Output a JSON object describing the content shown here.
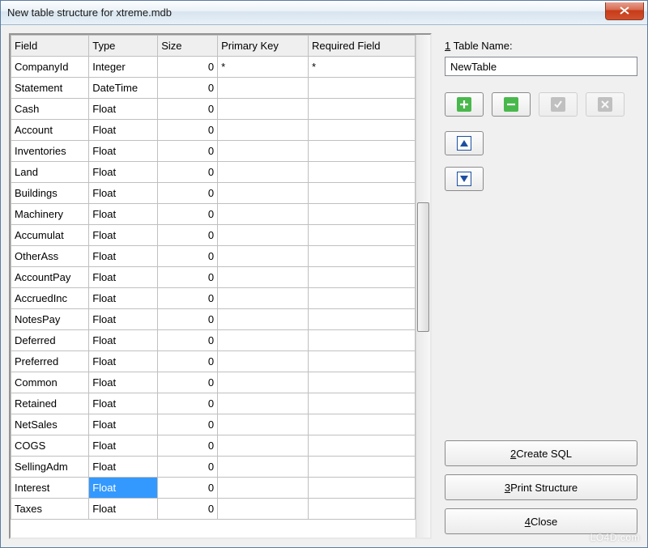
{
  "window": {
    "title": "New table structure for xtreme.mdb"
  },
  "columns": {
    "field": "Field",
    "type": "Type",
    "size": "Size",
    "pk": "Primary Key",
    "req": "Required Field"
  },
  "rows": [
    {
      "field": "CompanyId",
      "type": "Integer",
      "size": "0",
      "pk": "*",
      "req": "*"
    },
    {
      "field": "Statement",
      "type": "DateTime",
      "size": "0",
      "pk": "",
      "req": ""
    },
    {
      "field": "Cash",
      "type": "Float",
      "size": "0",
      "pk": "",
      "req": ""
    },
    {
      "field": "Account",
      "type": "Float",
      "size": "0",
      "pk": "",
      "req": ""
    },
    {
      "field": "Inventories",
      "type": "Float",
      "size": "0",
      "pk": "",
      "req": ""
    },
    {
      "field": "Land",
      "type": "Float",
      "size": "0",
      "pk": "",
      "req": ""
    },
    {
      "field": "Buildings",
      "type": "Float",
      "size": "0",
      "pk": "",
      "req": ""
    },
    {
      "field": "Machinery",
      "type": "Float",
      "size": "0",
      "pk": "",
      "req": ""
    },
    {
      "field": "Accumulat",
      "type": "Float",
      "size": "0",
      "pk": "",
      "req": ""
    },
    {
      "field": "OtherAss",
      "type": "Float",
      "size": "0",
      "pk": "",
      "req": ""
    },
    {
      "field": "AccountPay",
      "type": "Float",
      "size": "0",
      "pk": "",
      "req": ""
    },
    {
      "field": "AccruedInc",
      "type": "Float",
      "size": "0",
      "pk": "",
      "req": ""
    },
    {
      "field": "NotesPay",
      "type": "Float",
      "size": "0",
      "pk": "",
      "req": ""
    },
    {
      "field": "Deferred",
      "type": "Float",
      "size": "0",
      "pk": "",
      "req": ""
    },
    {
      "field": "Preferred",
      "type": "Float",
      "size": "0",
      "pk": "",
      "req": ""
    },
    {
      "field": "Common",
      "type": "Float",
      "size": "0",
      "pk": "",
      "req": ""
    },
    {
      "field": "Retained",
      "type": "Float",
      "size": "0",
      "pk": "",
      "req": ""
    },
    {
      "field": "NetSales",
      "type": "Float",
      "size": "0",
      "pk": "",
      "req": ""
    },
    {
      "field": "COGS",
      "type": "Float",
      "size": "0",
      "pk": "",
      "req": ""
    },
    {
      "field": "SellingAdm",
      "type": "Float",
      "size": "0",
      "pk": "",
      "req": ""
    },
    {
      "field": "Interest",
      "type": "Float",
      "size": "0",
      "pk": "",
      "req": "",
      "selected_col": "type"
    },
    {
      "field": "Taxes",
      "type": "Float",
      "size": "0",
      "pk": "",
      "req": ""
    }
  ],
  "side": {
    "tablename_label_prefix": "1",
    "tablename_label_rest": " Table Name:",
    "tablename_value": "NewTable"
  },
  "actions": {
    "create_prefix": "2",
    "create_rest": " Create SQL",
    "print_prefix": "3",
    "print_rest": " Print Structure",
    "close_prefix": "4",
    "close_rest": " Close"
  },
  "icons": {
    "add": "plus-icon",
    "remove": "minus-icon",
    "confirm": "check-icon",
    "cancel": "x-icon",
    "up": "arrow-up-icon",
    "down": "arrow-down-icon",
    "close_window": "close-icon"
  },
  "watermark": "LO4D.com"
}
